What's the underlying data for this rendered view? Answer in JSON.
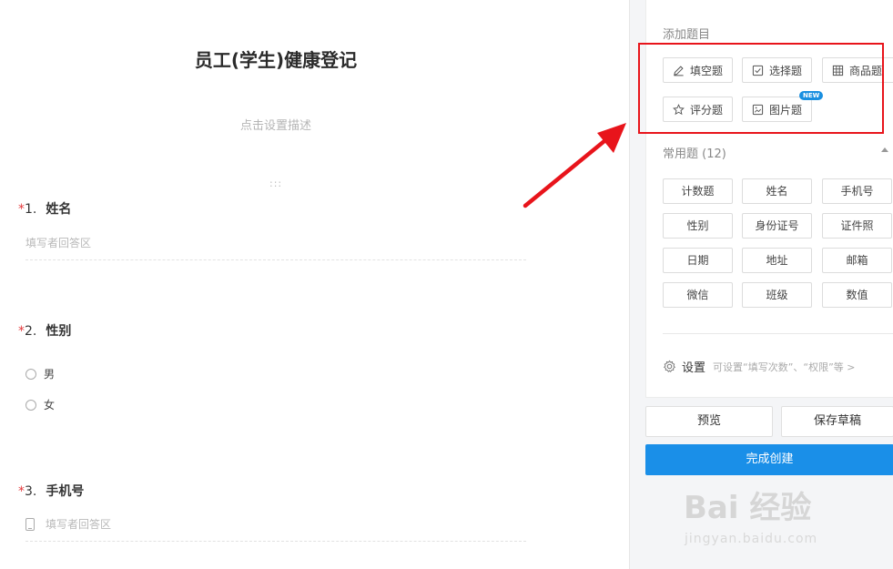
{
  "form": {
    "title": "员工(学生)健康登记",
    "description_placeholder": "点击设置描述",
    "drag_handle": ":::",
    "questions": [
      {
        "required_mark": "*",
        "number": "1.",
        "title": "姓名",
        "answer_placeholder": "填写者回答区"
      },
      {
        "required_mark": "*",
        "number": "2.",
        "title": "性别",
        "options": [
          "男",
          "女"
        ]
      },
      {
        "required_mark": "*",
        "number": "3.",
        "title": "手机号",
        "answer_placeholder": "填写者回答区"
      }
    ]
  },
  "panel": {
    "add_section_title": "添加题目",
    "add_buttons": [
      {
        "label": "填空题",
        "icon": "pencil-icon"
      },
      {
        "label": "选择题",
        "icon": "checkbox-icon"
      },
      {
        "label": "商品题",
        "icon": "table-icon"
      },
      {
        "label": "评分题",
        "icon": "star-icon"
      },
      {
        "label": "图片题",
        "icon": "image-icon",
        "badge": "NEW"
      }
    ],
    "common_section_title": "常用题 (12)",
    "common_buttons": [
      "计数题",
      "姓名",
      "手机号",
      "性别",
      "身份证号",
      "证件照",
      "日期",
      "地址",
      "邮箱",
      "微信",
      "班级",
      "数值"
    ],
    "settings_label": "设置",
    "settings_hint": "可设置“填写次数”、“权限”等 >",
    "preview_label": "预览",
    "save_draft_label": "保存草稿",
    "finish_label": "完成创建"
  },
  "watermark": {
    "brand": "Bai 经验",
    "url": "jingyan.baidu.com"
  },
  "colors": {
    "accent": "#1a8fe8",
    "highlight": "#e8141b",
    "required": "#e4393c"
  }
}
